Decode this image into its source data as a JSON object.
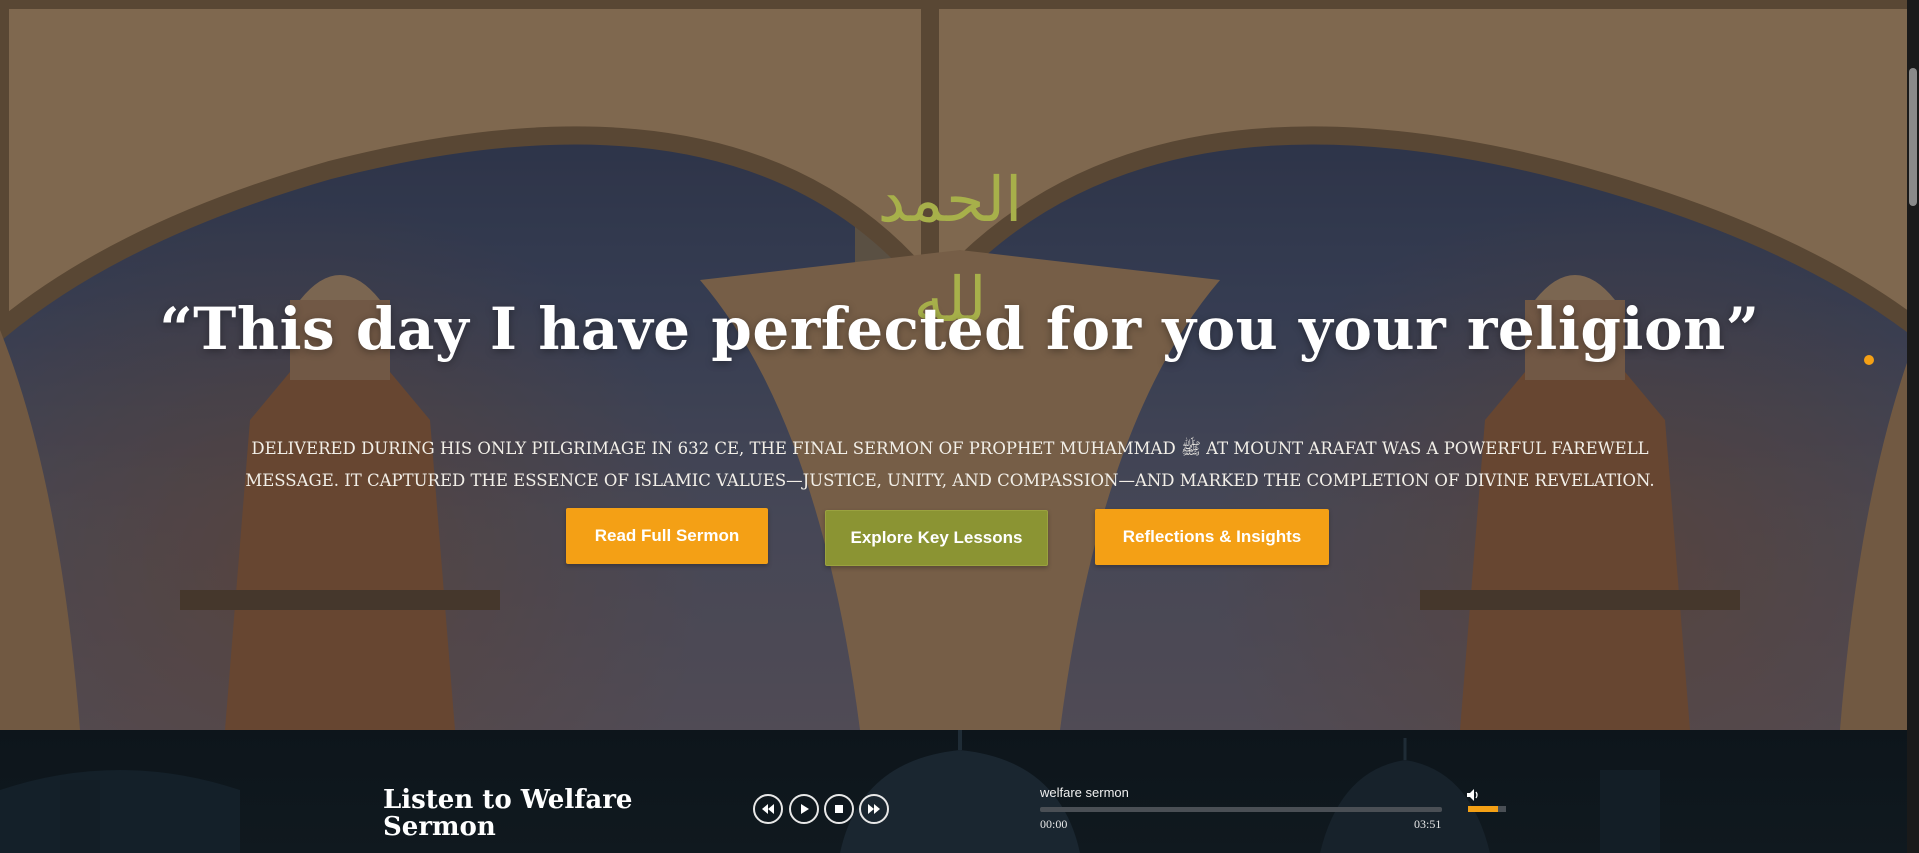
{
  "hero": {
    "calligraphy": "الحمد لله",
    "headline": "“This day I have perfected for you your religion”",
    "description": "Delivered during his only pilgrimage in 632 CE, the final sermon of Prophet Muhammad ﷺ at Mount Arafat was a powerful farewell message. It captured the essence of Islamic values—justice, unity, and compassion—and marked the completion of divine revelation.",
    "buttons": {
      "read": "Read Full Sermon",
      "explore": "Explore Key Lessons",
      "reflect": "Reflections & Insights"
    }
  },
  "audio": {
    "title": "Listen to Welfare Sermon",
    "track_title": "welfare sermon",
    "current_time": "00:00",
    "total_time": "03:51",
    "progress_fraction": 0,
    "volume_fraction": 0.8
  },
  "colors": {
    "accent": "#f4a015",
    "olive": "#8b9433",
    "calligraphy": "#a7b04a"
  },
  "icons": [
    "rewind-icon",
    "play-icon",
    "stop-icon",
    "forward-icon",
    "volume-icon"
  ]
}
